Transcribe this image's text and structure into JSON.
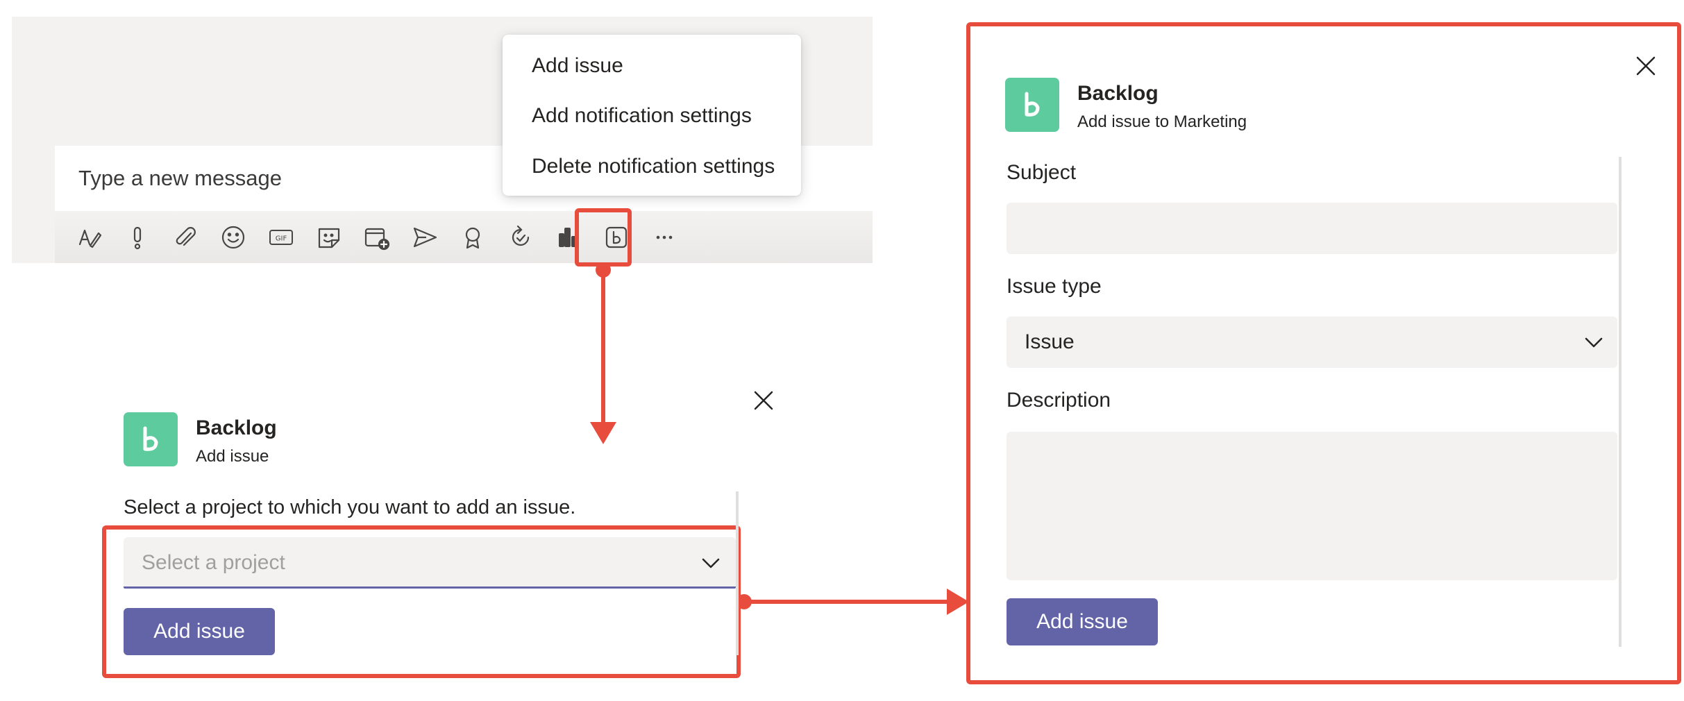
{
  "composer": {
    "placeholder": "Type a new message",
    "toolbar_icons": [
      "format-icon",
      "important-icon",
      "attach-icon",
      "emoji-icon",
      "gif-icon",
      "sticker-icon",
      "meet-now-icon",
      "send-icon",
      "praise-icon",
      "loop-icon",
      "stream-icon",
      "backlog-icon",
      "more-options-icon"
    ],
    "more_label": "···"
  },
  "menu": {
    "items": [
      "Add issue",
      "Add notification settings",
      "Delete notification settings"
    ]
  },
  "dialog_small": {
    "app_name": "Backlog",
    "subtitle": "Add issue",
    "prompt": "Select a project to which you want to add an issue.",
    "project_select_placeholder": "Select a project",
    "button_label": "Add issue"
  },
  "dialog_large": {
    "app_name": "Backlog",
    "subtitle": "Add issue to Marketing",
    "subject_label": "Subject",
    "subject_value": "",
    "issue_type_label": "Issue type",
    "issue_type_value": "Issue",
    "description_label": "Description",
    "description_value": "",
    "button_label": "Add issue"
  },
  "colors": {
    "accent": "#6264a7",
    "annotation": "#e74c3c",
    "app_logo": "#5ecb9f",
    "field_bg": "#f3f2f1"
  }
}
